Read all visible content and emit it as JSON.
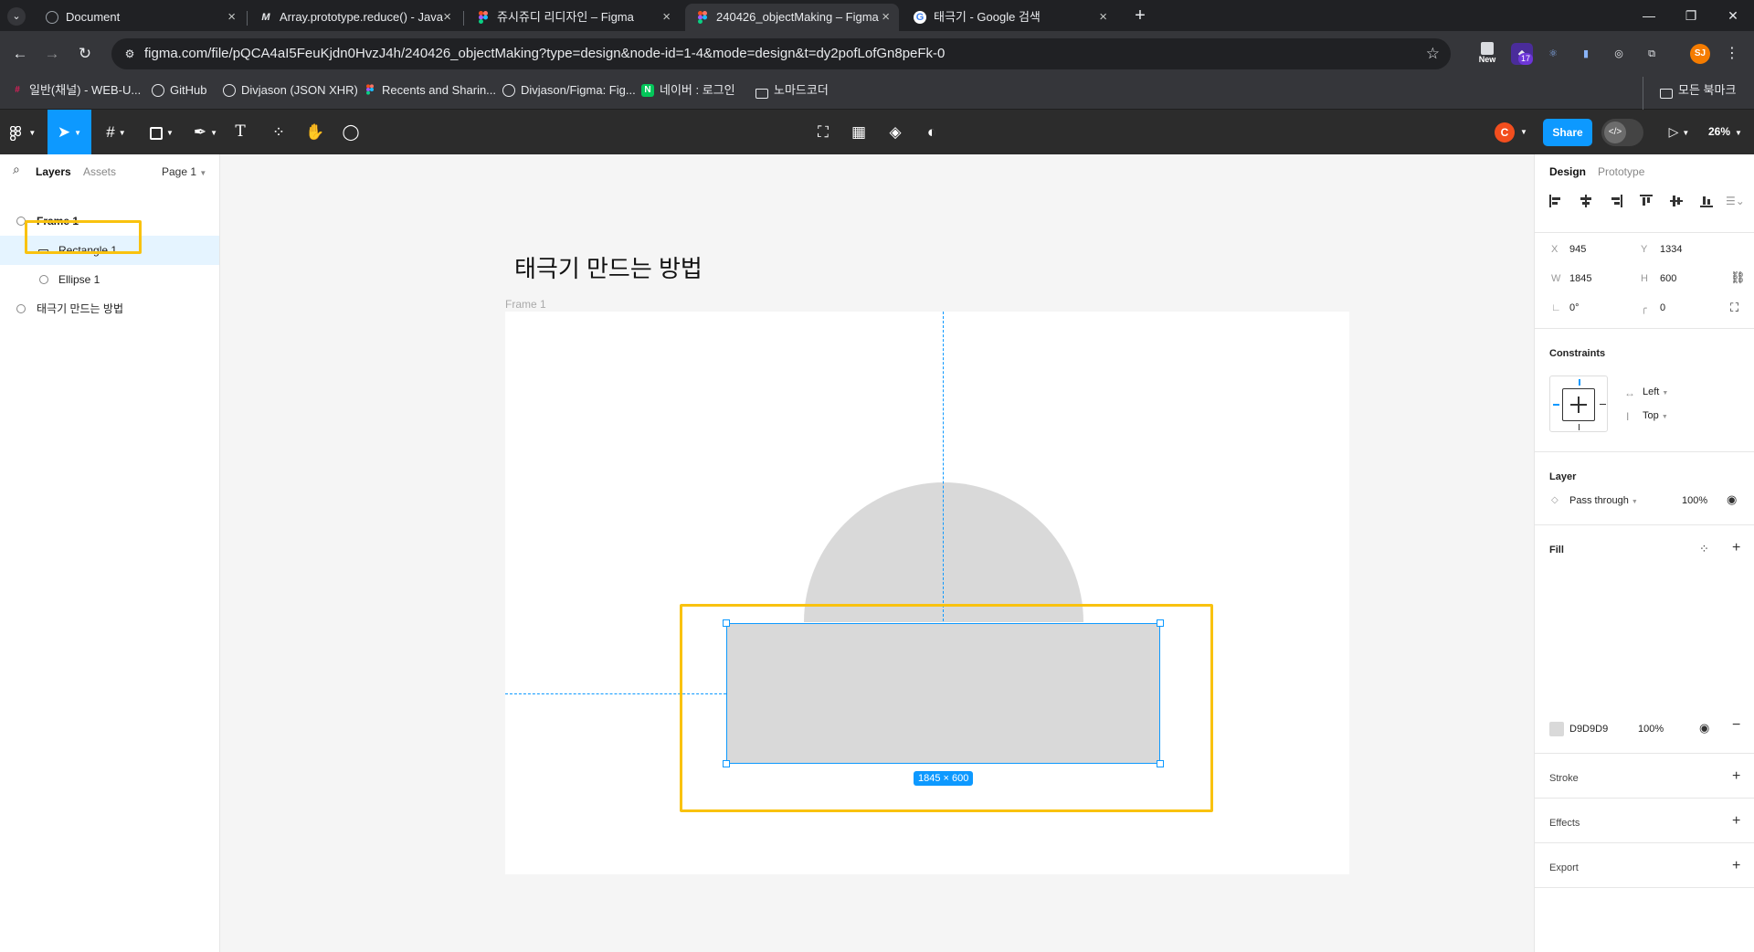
{
  "browser": {
    "tabs": [
      {
        "title": "Document",
        "icon": "globe-icon"
      },
      {
        "title": "Array.prototype.reduce() - Java",
        "icon": "mdn-icon"
      },
      {
        "title": "쥬시쥬디 리디자인 – Figma",
        "icon": "figma-icon"
      },
      {
        "title": "240426_objectMaking – Figma",
        "icon": "figma-icon"
      },
      {
        "title": "태극기 - Google 검색",
        "icon": "google-icon"
      }
    ],
    "new_tab": "+",
    "url": "figma.com/file/pQCA4aI5FeuKjdn0HvzJ4h/240426_objectMaking?type=design&node-id=1-4&mode=design&t=dy2pofLofGn8peFk-0",
    "extension_new_label": "New",
    "extension_badge": "17",
    "profile_initials": "SJ",
    "bookmarks": [
      {
        "label": "일반(채널) - WEB-U...",
        "icon": "slack-icon"
      },
      {
        "label": "GitHub",
        "icon": "github-icon"
      },
      {
        "label": "Divjason (JSON XHR)",
        "icon": "github-icon"
      },
      {
        "label": "Recents and Sharin...",
        "icon": "figma-icon"
      },
      {
        "label": "Divjason/Figma: Fig...",
        "icon": "github-icon"
      },
      {
        "label": "네이버 : 로그인",
        "icon": "naver-icon"
      },
      {
        "label": "노마드코더",
        "icon": "folder-icon"
      }
    ],
    "all_bookmarks": "모든 북마크"
  },
  "figma_toolbar": {
    "collaborator_initial": "C",
    "share_label": "Share",
    "zoom": "26%"
  },
  "left_panel": {
    "tabs": [
      "Layers",
      "Assets"
    ],
    "page": "Page 1",
    "layers": [
      {
        "name": "Frame 1",
        "type": "frame",
        "selected": false
      },
      {
        "name": "Rectangle 1",
        "type": "rectangle",
        "selected": true
      },
      {
        "name": "Ellipse 1",
        "type": "ellipse",
        "selected": false
      },
      {
        "name": "태극기 만드는 방법",
        "type": "text",
        "selected": false
      }
    ]
  },
  "canvas": {
    "title": "태극기 만드는 방법",
    "frame_label": "Frame 1",
    "size_badge": "1845 × 600",
    "help": "?"
  },
  "right_panel": {
    "tabs": [
      "Design",
      "Prototype"
    ],
    "position": {
      "x_label": "X",
      "x": "945",
      "y_label": "Y",
      "y": "1334"
    },
    "size": {
      "w_label": "W",
      "w": "1845",
      "h_label": "H",
      "h": "600"
    },
    "rotation": "0°",
    "radius": "0",
    "constraints": {
      "title": "Constraints",
      "horizontal": "Left",
      "vertical": "Top"
    },
    "layer": {
      "title": "Layer",
      "blend": "Pass through",
      "opacity": "100%"
    },
    "fill": {
      "title": "Fill",
      "hex": "D9D9D9",
      "opacity": "100%",
      "color": "#d9d9d9"
    },
    "stroke_title": "Stroke",
    "effects_title": "Effects",
    "export_title": "Export"
  },
  "colors": {
    "accent": "#0d99ff",
    "highlight": "#f9c20f",
    "shape_fill": "#d9d9d9"
  }
}
